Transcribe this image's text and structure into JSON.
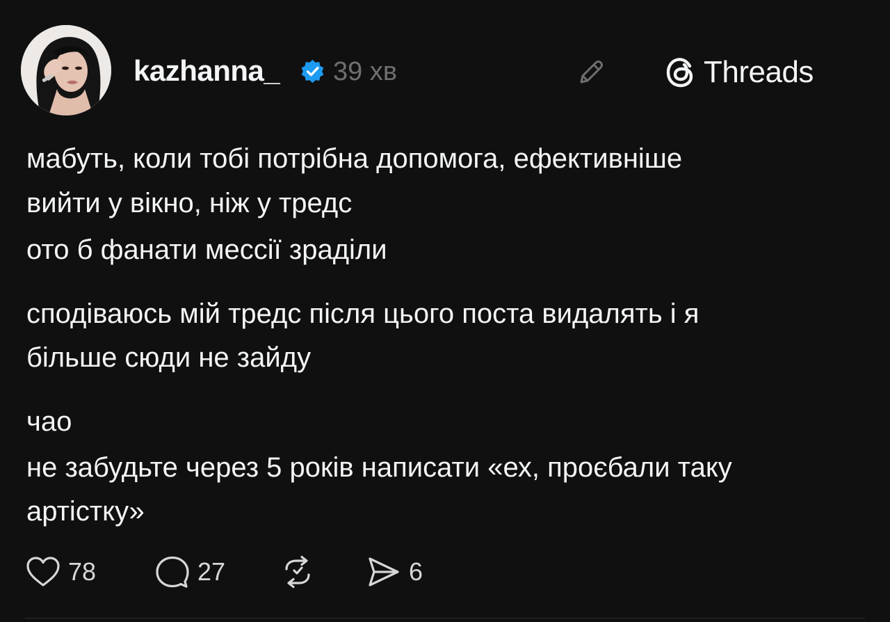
{
  "header": {
    "username": "kazhanna_",
    "time": "39 хв",
    "brand": "Threads"
  },
  "icons": {
    "avatar": "avatar-photo",
    "verified": "verified-badge-icon",
    "edit": "pencil-icon",
    "brand_logo": "threads-logo-icon",
    "like": "heart-icon",
    "reply": "comment-icon",
    "repost": "repost-icon",
    "share": "send-icon"
  },
  "colors": {
    "background": "#101010",
    "text": "#f3f5f7",
    "muted": "#6f6f6f",
    "verified": "#1d9bf0"
  },
  "post": {
    "lines": [
      "мабуть, коли тобі потрібна допомога, ефективніше",
      "вийти у вікно, ніж у тредс",
      "ото б фанати мессії зраділи",
      "сподіваюсь мій тредс після цього поста видалять і я",
      "більше сюди не зайду",
      "чао",
      "не забудьте через 5 років написати «ех, проєбали таку",
      "артістку»"
    ]
  },
  "actions": {
    "likes": "78",
    "replies": "27",
    "shares": "6"
  }
}
